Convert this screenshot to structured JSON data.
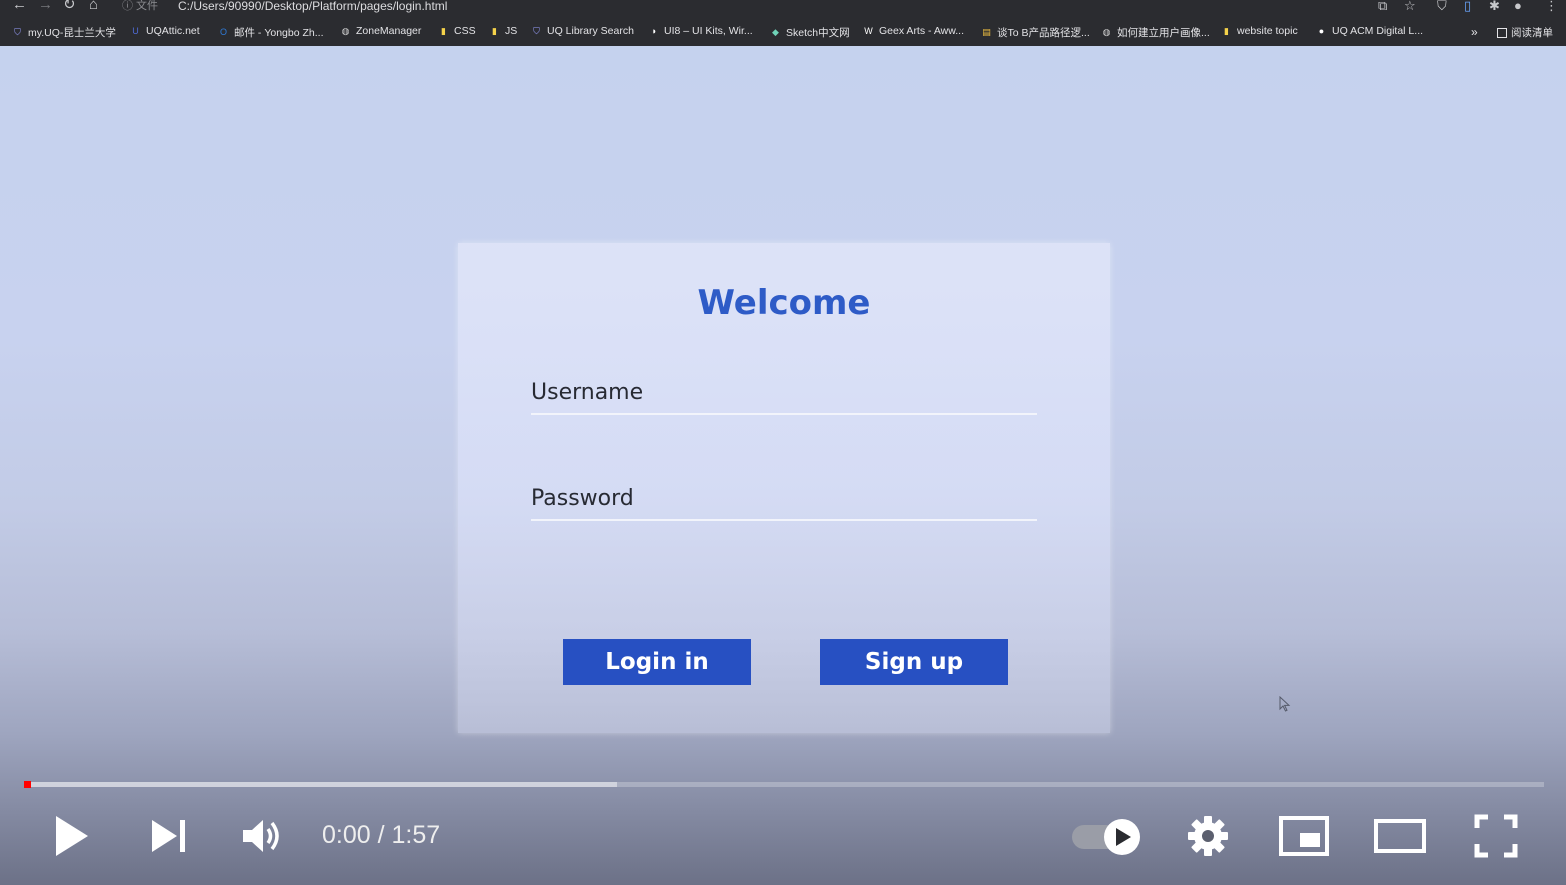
{
  "browser": {
    "address_info": "ⓘ 文件",
    "url": "C:/Users/90990/Desktop/Platform/pages/login.html",
    "bookmarks": [
      {
        "label": "my.UQ-昆士兰大学",
        "icon": "shield-icon",
        "color": "#9aa0ff"
      },
      {
        "label": "UQAttic.net",
        "icon": "uq-icon",
        "color": "#4f6bd8"
      },
      {
        "label": "邮件 - Yongbo Zh...",
        "icon": "outlook-icon",
        "color": "#2f7bd8"
      },
      {
        "label": "ZoneManager",
        "icon": "globe-icon",
        "color": "#d0d0d0"
      },
      {
        "label": "CSS",
        "icon": "folder-icon",
        "color": "#f5d24a"
      },
      {
        "label": "JS",
        "icon": "folder-icon",
        "color": "#f5d24a"
      },
      {
        "label": "UQ Library Search",
        "icon": "shield-icon",
        "color": "#9aa0ff"
      },
      {
        "label": "UI8 – UI Kits, Wir...",
        "icon": "ui8-icon",
        "color": "#ffffff"
      },
      {
        "label": "Sketch中文网",
        "icon": "diamond-icon",
        "color": "#6fd3b8"
      },
      {
        "label": "Geex Arts - Aww...",
        "icon": "w-icon",
        "color": "#ffffff"
      },
      {
        "label": "谈To B产品路径逻...",
        "icon": "bookmark-icon",
        "color": "#f0c040"
      },
      {
        "label": "如何建立用户画像...",
        "icon": "globe-icon",
        "color": "#d0d0d0"
      },
      {
        "label": "website topic",
        "icon": "folder-icon",
        "color": "#f5d24a"
      },
      {
        "label": "UQ ACM Digital L...",
        "icon": "acm-icon",
        "color": "#ffffff"
      }
    ],
    "more_bookmarks": "»",
    "reading_list": "阅读清单"
  },
  "login": {
    "title": "Welcome",
    "username_label": "Username",
    "password_label": "Password",
    "login_button": "Login in",
    "signup_button": "Sign up"
  },
  "player": {
    "time": "0:00 / 1:57",
    "progress_fraction": 0.0,
    "buffered_fraction": 0.39,
    "autoplay": true,
    "accent_color": "#ff0000"
  }
}
